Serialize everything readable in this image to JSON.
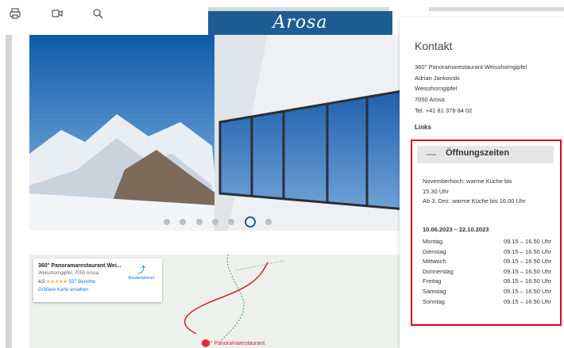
{
  "toolbar": {
    "icons": [
      "print-icon",
      "video-icon",
      "search-icon"
    ]
  },
  "brand": {
    "logo": "Arosa"
  },
  "carousel": {
    "slide_count": 7,
    "active_index": 6
  },
  "map": {
    "place_name": "360° Panoramarestaurant Wei...",
    "address": "Weisshorngipfel, 7050 Arosa",
    "rating": "4,5",
    "stars": "★★★★★",
    "reviews": "537 Berichte",
    "larger_map_link": "Größere Karte ansehen",
    "route_label": "Routenplaner",
    "marker_label": "360° Panoramarestaurant"
  },
  "contact": {
    "title": "Kontakt",
    "lines": [
      "360° Panoramarestaurant Weisshorngipfel",
      "Adrian Jankovski",
      "Weisshorngipfel",
      "7050 Arosa",
      "Tel. +41 81 378 84 02"
    ],
    "links_label": "Links"
  },
  "hours": {
    "toggle_symbol": "—",
    "title": "Öffnungszeiten",
    "notes": [
      "Novemberhoch: warme Küche bis",
      "15.30 Uhr",
      "Ab 3. Dez. warme Küche bis 16.00 Uhr"
    ],
    "period": "10.06.2023 – 22.10.2023",
    "days": [
      {
        "day": "Montag",
        "time": "09.15 – 16.50 Uhr"
      },
      {
        "day": "Dienstag",
        "time": "09.15 – 16.50 Uhr"
      },
      {
        "day": "Mittwoch",
        "time": "09.15 – 16.50 Uhr"
      },
      {
        "day": "Donnerstag",
        "time": "09.15 – 16.50 Uhr"
      },
      {
        "day": "Freitag",
        "time": "09.15 – 16.50 Uhr"
      },
      {
        "day": "Samstag",
        "time": "09.15 – 16.50 Uhr"
      },
      {
        "day": "Sonntag",
        "time": "09.15 – 16.50 Uhr"
      }
    ]
  },
  "colors": {
    "brand_blue": "#1d5d94",
    "highlight_red": "#e0001b",
    "map_link_blue": "#1a73e8"
  }
}
